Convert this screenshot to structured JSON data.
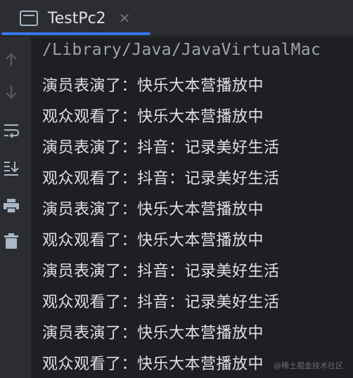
{
  "tab": {
    "title": "TestPc2",
    "close_glyph": "✕",
    "icon": "window-icon"
  },
  "toolbar": {
    "icons": [
      "arrow-up-icon",
      "arrow-down-icon",
      "soft-wrap-icon",
      "scroll-to-end-icon",
      "print-icon",
      "trash-icon"
    ]
  },
  "console": {
    "path_line": "/Library/Java/JavaVirtualMac",
    "lines": [
      "演员表演了：快乐大本营播放中",
      "观众观看了：快乐大本营播放中",
      "演员表演了：抖音：记录美好生活",
      "观众观看了：抖音：记录美好生活",
      "演员表演了：快乐大本营播放中",
      "观众观看了：快乐大本营播放中",
      "演员表演了：抖音：记录美好生活",
      "观众观看了：抖音：记录美好生活",
      "演员表演了：快乐大本营播放中",
      "观众观看了：快乐大本营播放中"
    ],
    "watermark": "@稀土掘金技术社区"
  },
  "colors": {
    "accent": "#3574f0",
    "console_bg": "#1e1f22",
    "panel_bg": "#2b2d30",
    "text": "#dfe1e5"
  }
}
